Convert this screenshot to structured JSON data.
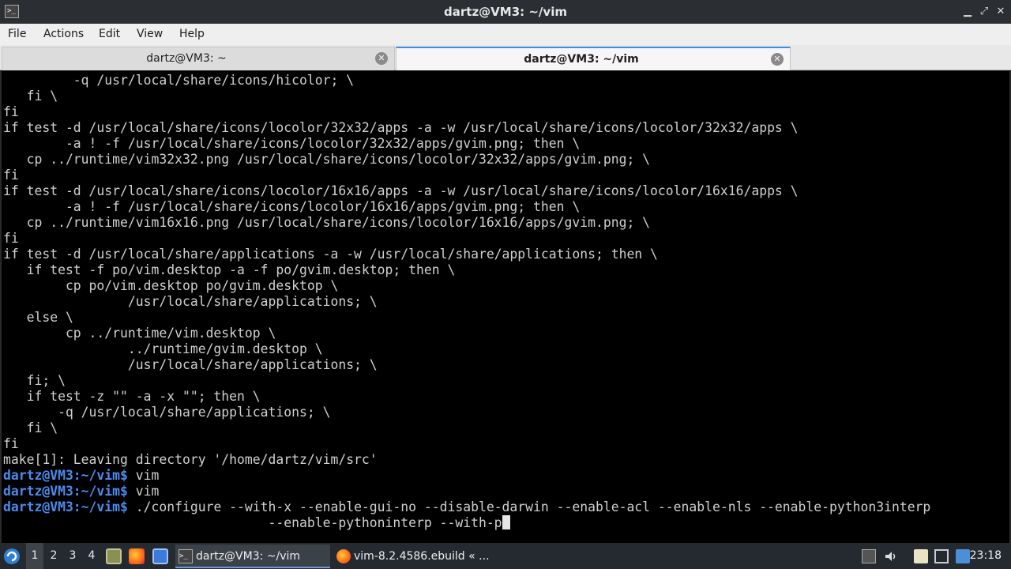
{
  "window": {
    "title": "dartz@VM3: ~/vim",
    "minimize": "▁",
    "maximize": "⤢",
    "close": "✕"
  },
  "menu": [
    "File",
    "Actions",
    "Edit",
    "View",
    "Help"
  ],
  "tabs": [
    {
      "label": "dartz@VM3: ~",
      "active": false
    },
    {
      "label": "dartz@VM3: ~/vim",
      "active": true
    }
  ],
  "terminal": {
    "lines": [
      {
        "text": "         -q /usr/local/share/icons/hicolor; \\"
      },
      {
        "text": "   fi \\"
      },
      {
        "text": "fi"
      },
      {
        "text": "if test -d /usr/local/share/icons/locolor/32x32/apps -a -w /usr/local/share/icons/locolor/32x32/apps \\"
      },
      {
        "text": "        -a ! -f /usr/local/share/icons/locolor/32x32/apps/gvim.png; then \\"
      },
      {
        "text": "   cp ../runtime/vim32x32.png /usr/local/share/icons/locolor/32x32/apps/gvim.png; \\"
      },
      {
        "text": "fi"
      },
      {
        "text": "if test -d /usr/local/share/icons/locolor/16x16/apps -a -w /usr/local/share/icons/locolor/16x16/apps \\"
      },
      {
        "text": "        -a ! -f /usr/local/share/icons/locolor/16x16/apps/gvim.png; then \\"
      },
      {
        "text": "   cp ../runtime/vim16x16.png /usr/local/share/icons/locolor/16x16/apps/gvim.png; \\"
      },
      {
        "text": "fi"
      },
      {
        "text": "if test -d /usr/local/share/applications -a -w /usr/local/share/applications; then \\"
      },
      {
        "text": "   if test -f po/vim.desktop -a -f po/gvim.desktop; then \\"
      },
      {
        "text": "        cp po/vim.desktop po/gvim.desktop \\"
      },
      {
        "text": "                /usr/local/share/applications; \\"
      },
      {
        "text": "   else \\"
      },
      {
        "text": "        cp ../runtime/vim.desktop \\"
      },
      {
        "text": "                ../runtime/gvim.desktop \\"
      },
      {
        "text": "                /usr/local/share/applications; \\"
      },
      {
        "text": "   fi; \\"
      },
      {
        "text": "   if test -z \"\" -a -x \"\"; then \\"
      },
      {
        "text": "       -q /usr/local/share/applications; \\"
      },
      {
        "text": "   fi \\"
      },
      {
        "text": "fi"
      },
      {
        "text": "make[1]: Leaving directory '/home/dartz/vim/src'"
      },
      {
        "prompt": "dartz@VM3:~/vim$",
        "text": " vim"
      },
      {
        "prompt": "dartz@VM3:~/vim$",
        "text": " vim"
      },
      {
        "prompt": "dartz@VM3:~/vim$",
        "text": " ./configure --with-x --enable-gui-no --disable-darwin --enable-acl --enable-nls --enable-python3interp"
      },
      {
        "text": "                                  --enable-pythoninterp --with-p",
        "cursor": true
      }
    ]
  },
  "taskbar": {
    "workspaces": [
      "1",
      "2",
      "3",
      "4"
    ],
    "active_workspace": "1",
    "tasks": [
      {
        "label": "dartz@VM3: ~/vim",
        "active": true,
        "icon": "terminal-icon"
      },
      {
        "label": "vim-8.2.4586.ebuild « ...",
        "active": false,
        "icon": "firefox-icon"
      }
    ],
    "clock": "23:18",
    "colors": {
      "terminal_prompt": "#4a8cf0",
      "tab_accent": "#3d8ee0"
    }
  }
}
